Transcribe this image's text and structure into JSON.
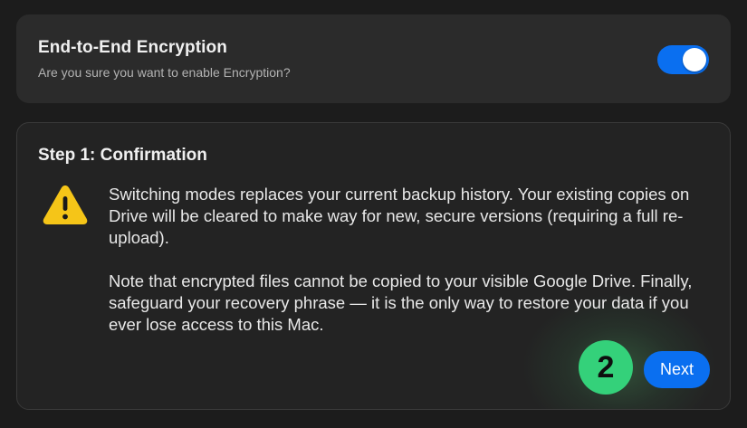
{
  "encryption": {
    "title": "End-to-End Encryption",
    "subtitle": "Are you sure you want to enable Encryption?",
    "toggle_on": true
  },
  "step": {
    "title": "Step 1: Confirmation",
    "warning_icon": "warning-triangle-icon",
    "paragraph1": "Switching modes replaces your current backup history. Your existing copies on Drive will be cleared to make way for new, secure versions (requiring a full re-upload).",
    "paragraph2": "Note that encrypted files cannot be copied to your visible Google Drive. Finally, safeguard your recovery phrase — it is the only way to restore your data if you ever lose access to this Mac."
  },
  "annotation": {
    "badge_number": "2"
  },
  "actions": {
    "next_label": "Next"
  },
  "colors": {
    "accent": "#0a6ff0",
    "badge": "#34d17a",
    "warning": "#f5c518"
  }
}
